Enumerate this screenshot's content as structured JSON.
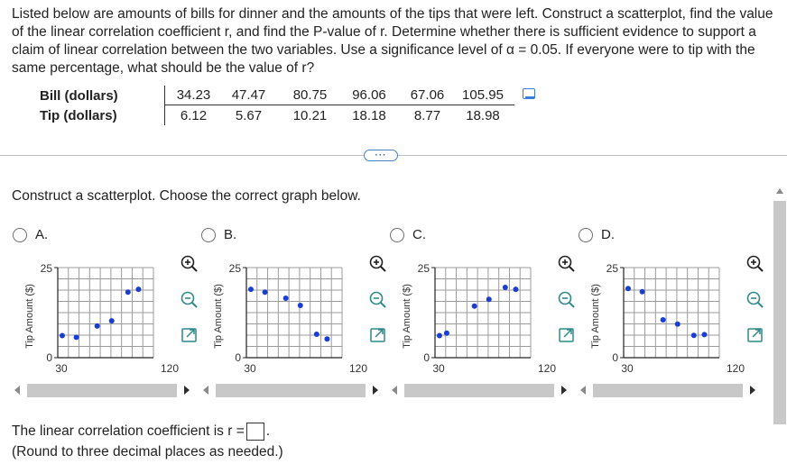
{
  "question": {
    "text": "Listed below are amounts of bills for dinner and the amounts of the tips that were left. Construct a scatterplot, find the value of the linear correlation coefficient r, and find the P-value of r. Determine whether there is sufficient evidence to support a claim of linear correlation between the two variables. Use a significance level of α = 0.05. If everyone were to tip with the same percentage, what should be the value of r?"
  },
  "table": {
    "row1_label": "Bill (dollars)",
    "row2_label": "Tip (dollars)",
    "bills": [
      "34.23",
      "47.47",
      "80.75",
      "96.06",
      "67.06",
      "105.95"
    ],
    "tips": [
      "6.12",
      "5.67",
      "10.21",
      "18.18",
      "8.77",
      "18.98"
    ],
    "copy_icon": "copy-icon"
  },
  "more_button": "···",
  "prompt": "Construct a scatterplot. Choose the correct graph below.",
  "options": [
    {
      "label": "A.",
      "points": [
        [
          34.23,
          6.12
        ],
        [
          47.47,
          5.67
        ],
        [
          67.06,
          8.77
        ],
        [
          80.75,
          10.21
        ],
        [
          96.06,
          18.18
        ],
        [
          105.95,
          18.98
        ]
      ]
    },
    {
      "label": "B.",
      "points": [
        [
          34.23,
          18.98
        ],
        [
          47.47,
          18.18
        ],
        [
          67.06,
          16.5
        ],
        [
          80.75,
          14.5
        ],
        [
          96.06,
          6.5
        ],
        [
          105.95,
          5.2
        ]
      ]
    },
    {
      "label": "C.",
      "points": [
        [
          34.23,
          6.12
        ],
        [
          41,
          6.8
        ],
        [
          67.06,
          14.3
        ],
        [
          80.75,
          16.2
        ],
        [
          96.06,
          19.5
        ],
        [
          105.95,
          18.98
        ]
      ]
    },
    {
      "label": "D.",
      "points": [
        [
          34.23,
          19.2
        ],
        [
          47.47,
          18.3
        ],
        [
          67.06,
          10.5
        ],
        [
          80.75,
          9.3
        ],
        [
          96.06,
          6.2
        ],
        [
          105.95,
          6.4
        ]
      ]
    }
  ],
  "chart_data": [
    {
      "type": "scatter",
      "ylabel": "Tip Amount ($)",
      "x_ticks": [
        "30",
        "120"
      ],
      "y_ticks": [
        "0",
        "25"
      ],
      "xlim": [
        30,
        120
      ],
      "ylim": [
        0,
        25
      ],
      "grid": true
    },
    {
      "type": "scatter",
      "ylabel": "Tip Amount ($)",
      "x_ticks": [
        "30",
        "120"
      ],
      "y_ticks": [
        "0",
        "25"
      ],
      "xlim": [
        30,
        120
      ],
      "ylim": [
        0,
        25
      ],
      "grid": true
    },
    {
      "type": "scatter",
      "ylabel": "Tip Amount ($)",
      "x_ticks": [
        "30",
        "120"
      ],
      "y_ticks": [
        "0",
        "25"
      ],
      "xlim": [
        30,
        120
      ],
      "ylim": [
        0,
        25
      ],
      "grid": true
    },
    {
      "type": "scatter",
      "ylabel": "Tip Amount ($)",
      "x_ticks": [
        "30",
        "120"
      ],
      "y_ticks": [
        "0",
        "25"
      ],
      "xlim": [
        30,
        120
      ],
      "ylim": [
        0,
        25
      ],
      "grid": true
    }
  ],
  "answer": {
    "prefix": "The linear correlation coefficient is r =",
    "period": ".",
    "note": "(Round to three decimal places as needed.)"
  },
  "colors": {
    "point": "#1a3fd0",
    "grid": "#9b9b9b",
    "axis": "#222222"
  }
}
